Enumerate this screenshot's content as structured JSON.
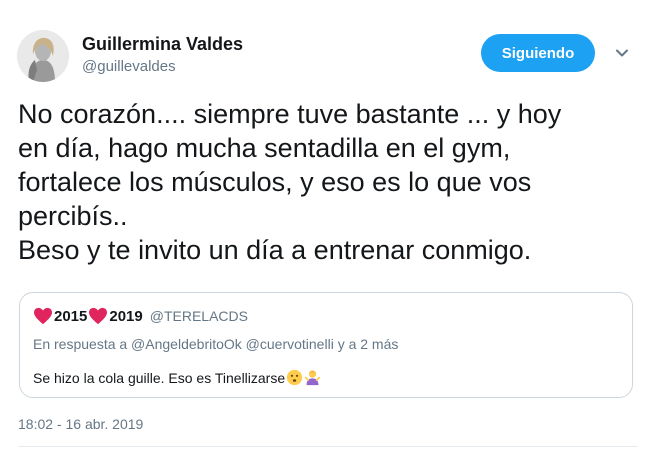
{
  "author": {
    "name": "Guillermina Valdes",
    "handle": "@guillevaldes",
    "avatar_icon": "profile-photo"
  },
  "follow_button": {
    "label": "Siguiendo",
    "color": "#1da1f2"
  },
  "menu_icon": "chevron-down-icon",
  "tweet": {
    "lines": [
      "No corazón.... siempre tuve bastante ... y hoy",
      "en día, hago mucha  sentadilla en el gym,",
      "fortalece los músculos, y eso es lo que vos",
      "percibís..",
      "Beso y te invito un día a entrenar conmigo."
    ]
  },
  "quoted_tweet": {
    "name_part1": "2015",
    "name_part2": "2019",
    "name_icons": [
      "heart-icon",
      "heart-icon"
    ],
    "handle": "@TERELACDS",
    "reply_to": "En respuesta a @AngeldebritoOk @cuervotinelli y a 2 más",
    "text": "Se hizo la cola guille. Eso es Tinellizarse",
    "emojis": [
      "hushed-face-icon",
      "person-shrugging-icon"
    ]
  },
  "timestamp": "18:02 - 16 abr. 2019",
  "colors": {
    "text": "#14171a",
    "muted": "#657786",
    "border": "#ccd6dd",
    "heart": "#e0245e"
  }
}
